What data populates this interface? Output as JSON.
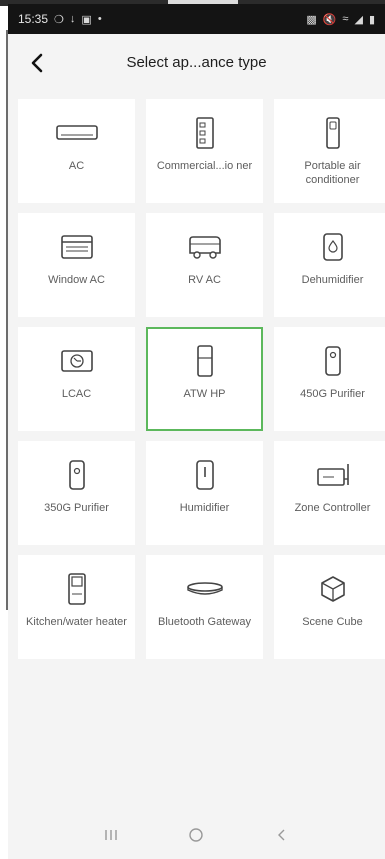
{
  "status_bar": {
    "time": "15:35",
    "left_icons": [
      "notification-icon",
      "download-icon",
      "gallery-icon",
      "dot-icon"
    ],
    "right_icons": [
      "nfc-icon",
      "mute-icon",
      "wifi-icon",
      "signal-icon",
      "battery-icon"
    ]
  },
  "header": {
    "title": "Select ap...ance type"
  },
  "appliances": [
    {
      "label": "AC",
      "icon": "ac-unit-icon",
      "selected": false
    },
    {
      "label": "Commercial...io ner",
      "icon": "commercial-ac-icon",
      "selected": false
    },
    {
      "label": "Portable air conditioner",
      "icon": "portable-ac-icon",
      "selected": false
    },
    {
      "label": "Window AC",
      "icon": "window-ac-icon",
      "selected": false
    },
    {
      "label": "RV AC",
      "icon": "rv-ac-icon",
      "selected": false
    },
    {
      "label": "Dehumidifier",
      "icon": "dehumidifier-icon",
      "selected": false
    },
    {
      "label": "LCAC",
      "icon": "lcac-icon",
      "selected": false
    },
    {
      "label": "ATW HP",
      "icon": "heat-pump-icon",
      "selected": true
    },
    {
      "label": "450G Purifier",
      "icon": "purifier-icon",
      "selected": false
    },
    {
      "label": "350G Purifier",
      "icon": "small-purifier-icon",
      "selected": false
    },
    {
      "label": "Humidifier",
      "icon": "humidifier-icon",
      "selected": false
    },
    {
      "label": "Zone Controller",
      "icon": "zone-controller-icon",
      "selected": false
    },
    {
      "label": "Kitchen/water heater",
      "icon": "water-heater-icon",
      "selected": false
    },
    {
      "label": "Bluetooth Gateway",
      "icon": "bluetooth-gateway-icon",
      "selected": false
    },
    {
      "label": "Scene Cube",
      "icon": "scene-cube-icon",
      "selected": false
    }
  ],
  "nav": {
    "recent": "recent-apps-icon",
    "home": "home-icon",
    "back": "nav-back-icon"
  },
  "colors": {
    "selected_border": "#5cb85c",
    "background": "#f4f4f4",
    "tile": "#ffffff"
  }
}
